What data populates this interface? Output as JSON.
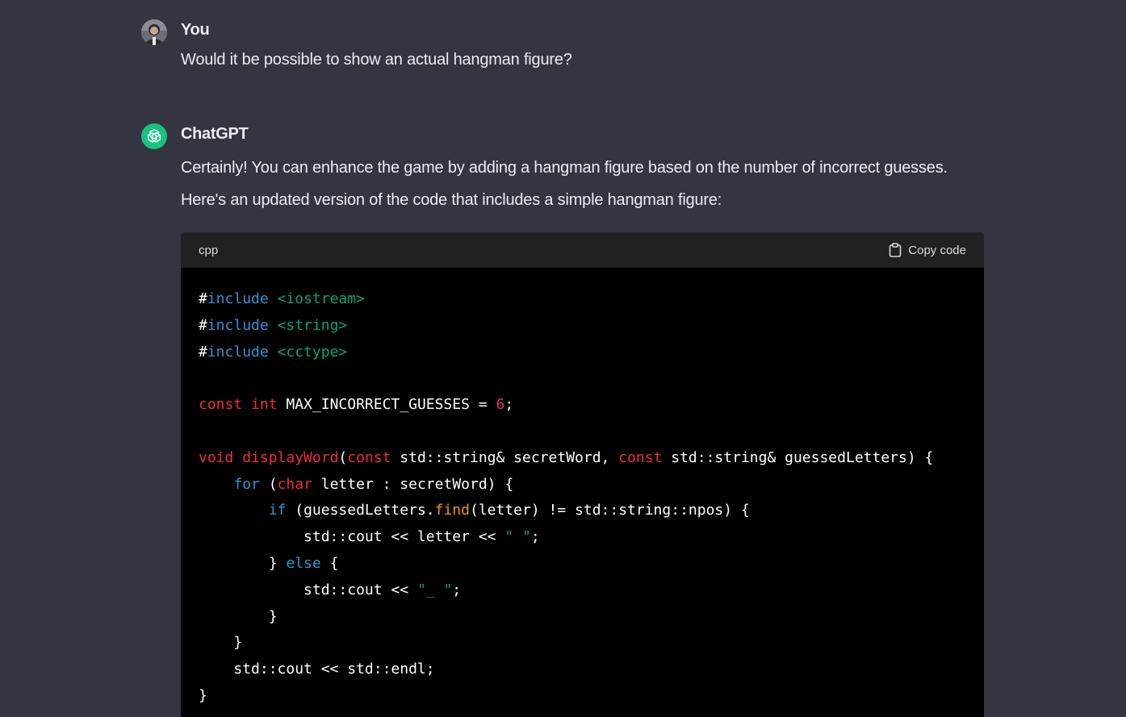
{
  "conversation": {
    "user_message": {
      "author": "You",
      "text": "Would it be possible to show an actual hangman figure?",
      "avatar_icon": "user-avatar-photo"
    },
    "assistant_message": {
      "author": "ChatGPT",
      "text": "Certainly! You can enhance the game by adding a hangman figure based on the number of incorrect guesses. Here's an updated version of the code that includes a simple hangman figure:",
      "avatar_icon": "openai-logo-icon",
      "avatar_color": "#19c37d"
    }
  },
  "code_block": {
    "language": "cpp",
    "copy_label": "Copy code",
    "copy_icon": "clipboard-icon",
    "lines": [
      [
        {
          "t": "#",
          "c": "hash"
        },
        {
          "t": "include",
          "c": "kw-blue"
        },
        {
          "t": " ",
          "c": "plain"
        },
        {
          "t": "<iostream>",
          "c": "str"
        }
      ],
      [
        {
          "t": "#",
          "c": "hash"
        },
        {
          "t": "include",
          "c": "kw-blue"
        },
        {
          "t": " ",
          "c": "plain"
        },
        {
          "t": "<string>",
          "c": "str"
        }
      ],
      [
        {
          "t": "#",
          "c": "hash"
        },
        {
          "t": "include",
          "c": "kw-blue"
        },
        {
          "t": " ",
          "c": "plain"
        },
        {
          "t": "<cctype>",
          "c": "str"
        }
      ],
      [],
      [
        {
          "t": "const",
          "c": "kw-red"
        },
        {
          "t": " ",
          "c": "plain"
        },
        {
          "t": "int",
          "c": "kw-red"
        },
        {
          "t": " MAX_INCORRECT_GUESSES = ",
          "c": "plain"
        },
        {
          "t": "6",
          "c": "num"
        },
        {
          "t": ";",
          "c": "plain"
        }
      ],
      [],
      [
        {
          "t": "void",
          "c": "kw-red"
        },
        {
          "t": " ",
          "c": "plain"
        },
        {
          "t": "displayWord",
          "c": "fn"
        },
        {
          "t": "(",
          "c": "plain"
        },
        {
          "t": "const",
          "c": "kw-red"
        },
        {
          "t": " std::string& secretWord, ",
          "c": "plain"
        },
        {
          "t": "const",
          "c": "kw-red"
        },
        {
          "t": " std::string& guessedLetters) {",
          "c": "plain"
        }
      ],
      [
        {
          "t": "    ",
          "c": "plain"
        },
        {
          "t": "for",
          "c": "kw-blue"
        },
        {
          "t": " (",
          "c": "plain"
        },
        {
          "t": "char",
          "c": "kw-red"
        },
        {
          "t": " letter : secretWord) {",
          "c": "plain"
        }
      ],
      [
        {
          "t": "        ",
          "c": "plain"
        },
        {
          "t": "if",
          "c": "kw-blue"
        },
        {
          "t": " (guessedLetters.",
          "c": "plain"
        },
        {
          "t": "find",
          "c": "method"
        },
        {
          "t": "(letter) != std::string::npos) {",
          "c": "plain"
        }
      ],
      [
        {
          "t": "            std::cout << letter << ",
          "c": "plain"
        },
        {
          "t": "\" \"",
          "c": "str"
        },
        {
          "t": ";",
          "c": "plain"
        }
      ],
      [
        {
          "t": "        } ",
          "c": "plain"
        },
        {
          "t": "else",
          "c": "kw-blue"
        },
        {
          "t": " {",
          "c": "plain"
        }
      ],
      [
        {
          "t": "            std::cout << ",
          "c": "plain"
        },
        {
          "t": "\"_ \"",
          "c": "str"
        },
        {
          "t": ";",
          "c": "plain"
        }
      ],
      [
        {
          "t": "        }",
          "c": "plain"
        }
      ],
      [
        {
          "t": "    }",
          "c": "plain"
        }
      ],
      [
        {
          "t": "    std::cout << std::endl;",
          "c": "plain"
        }
      ],
      [
        {
          "t": "}",
          "c": "plain"
        }
      ]
    ]
  }
}
